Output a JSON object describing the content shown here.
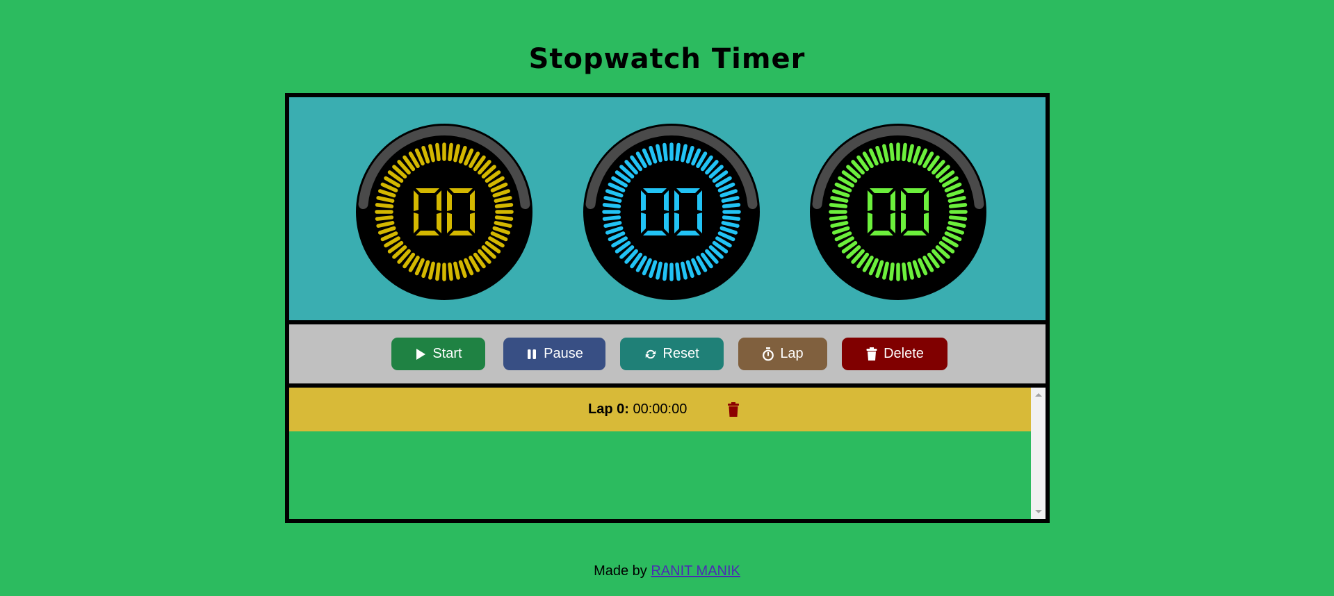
{
  "title": "Stopwatch Timer",
  "dials": [
    {
      "name": "hours",
      "value": "00",
      "color": "#d4b800"
    },
    {
      "name": "minutes",
      "value": "00",
      "color": "#22c3f5"
    },
    {
      "name": "seconds",
      "value": "00",
      "color": "#6cf03c"
    }
  ],
  "controls": {
    "start": {
      "label": "Start",
      "icon": "play-icon",
      "color": "#1f8243"
    },
    "pause": {
      "label": "Pause",
      "icon": "pause-icon",
      "color": "#384f84"
    },
    "reset": {
      "label": "Reset",
      "icon": "refresh-icon",
      "color": "#1f8077"
    },
    "lap": {
      "label": "Lap",
      "icon": "stopwatch-icon",
      "color": "#80603e"
    },
    "delete": {
      "label": "Delete",
      "icon": "trash-icon",
      "color": "#800000"
    }
  },
  "laps": [
    {
      "label": "Lap 0:",
      "time": "00:00:00"
    }
  ],
  "footer": {
    "prefix": "Made by",
    "author": "RANIT MANIK"
  }
}
